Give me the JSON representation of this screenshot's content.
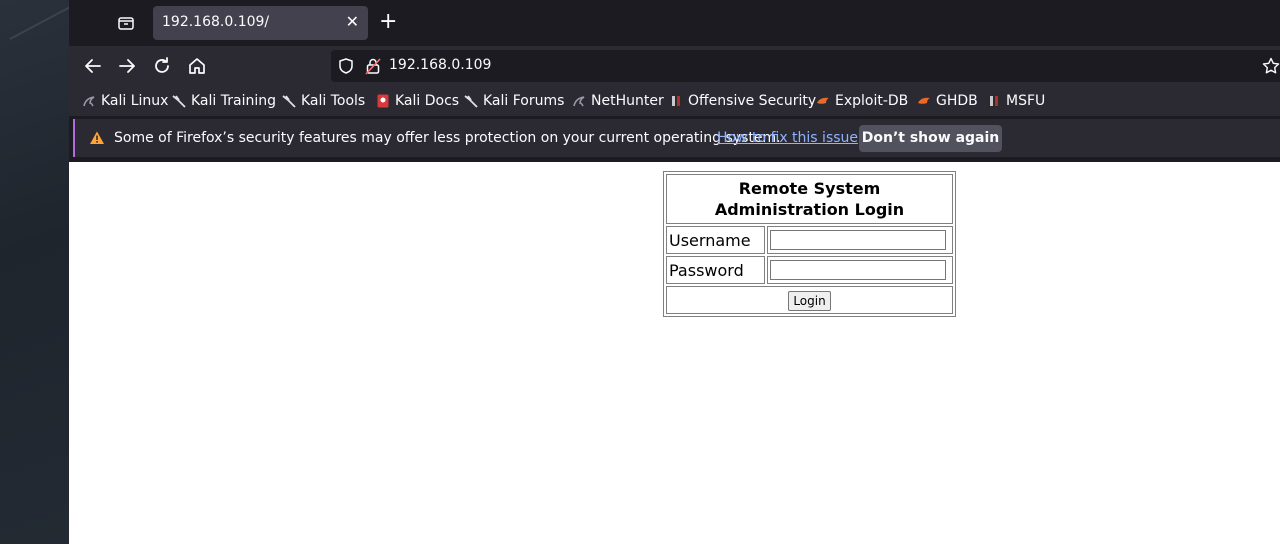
{
  "tab": {
    "title": "192.168.0.109/",
    "close_glyph": "✕",
    "new_tab_glyph": "+"
  },
  "urlbar": {
    "url": "192.168.0.109"
  },
  "bookmarks": [
    {
      "label": "Kali Linux",
      "icon": "kali-dragon-icon",
      "color": "#9a9aa8"
    },
    {
      "label": "Kali Training",
      "icon": "kali-dragon-icon",
      "color": "#e0e0e6"
    },
    {
      "label": "Kali Tools",
      "icon": "kali-dragon-icon",
      "color": "#e0e0e6"
    },
    {
      "label": "Kali Docs",
      "icon": "kali-docs-icon",
      "color": "#d63a3a"
    },
    {
      "label": "Kali Forums",
      "icon": "kali-dragon-icon",
      "color": "#e0e0e6"
    },
    {
      "label": "NetHunter",
      "icon": "kali-dragon-icon",
      "color": "#9a9aa8"
    },
    {
      "label": "Offensive Security",
      "icon": "offsec-icon",
      "color": "#c9c9cf"
    },
    {
      "label": "Exploit-DB",
      "icon": "exploit-db-icon",
      "color": "#e86a2a"
    },
    {
      "label": "GHDB",
      "icon": "ghdb-icon",
      "color": "#e86a2a"
    },
    {
      "label": "MSFU",
      "icon": "offsec-icon",
      "color": "#c9c9cf"
    }
  ],
  "notice": {
    "text": "Some of Firefox’s security features may offer less protection on your current operating system.",
    "link": "How to fix this issue",
    "button": "Don’t show again",
    "accent": "#b26cdd",
    "warning_color": "#ffa436"
  },
  "login": {
    "heading": "Remote System Administration Login",
    "username_label": "Username",
    "password_label": "Password",
    "username_value": "",
    "password_value": "",
    "button": "Login"
  }
}
